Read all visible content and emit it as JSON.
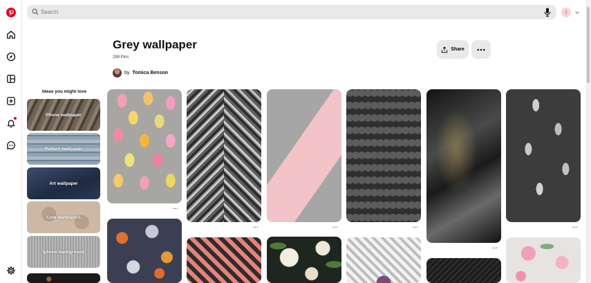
{
  "search": {
    "placeholder": "Search"
  },
  "user": {
    "initial": "I"
  },
  "board": {
    "title": "Grey wallpaper",
    "pin_count": "259 Pins",
    "by": "by",
    "owner": "Tomica Benson"
  },
  "actions": {
    "share_label": "Share"
  },
  "ideas": {
    "title": "Ideas you might love",
    "items": [
      {
        "label": "Phone wallpaper"
      },
      {
        "label": "Pattern wallpaper"
      },
      {
        "label": "Art wallpaper"
      },
      {
        "label": "Cute wallpapers"
      },
      {
        "label": "Iphone background"
      }
    ]
  },
  "pin_more": "···",
  "colors": {
    "brand": "#e60023",
    "bar": "#e9e9e9"
  }
}
